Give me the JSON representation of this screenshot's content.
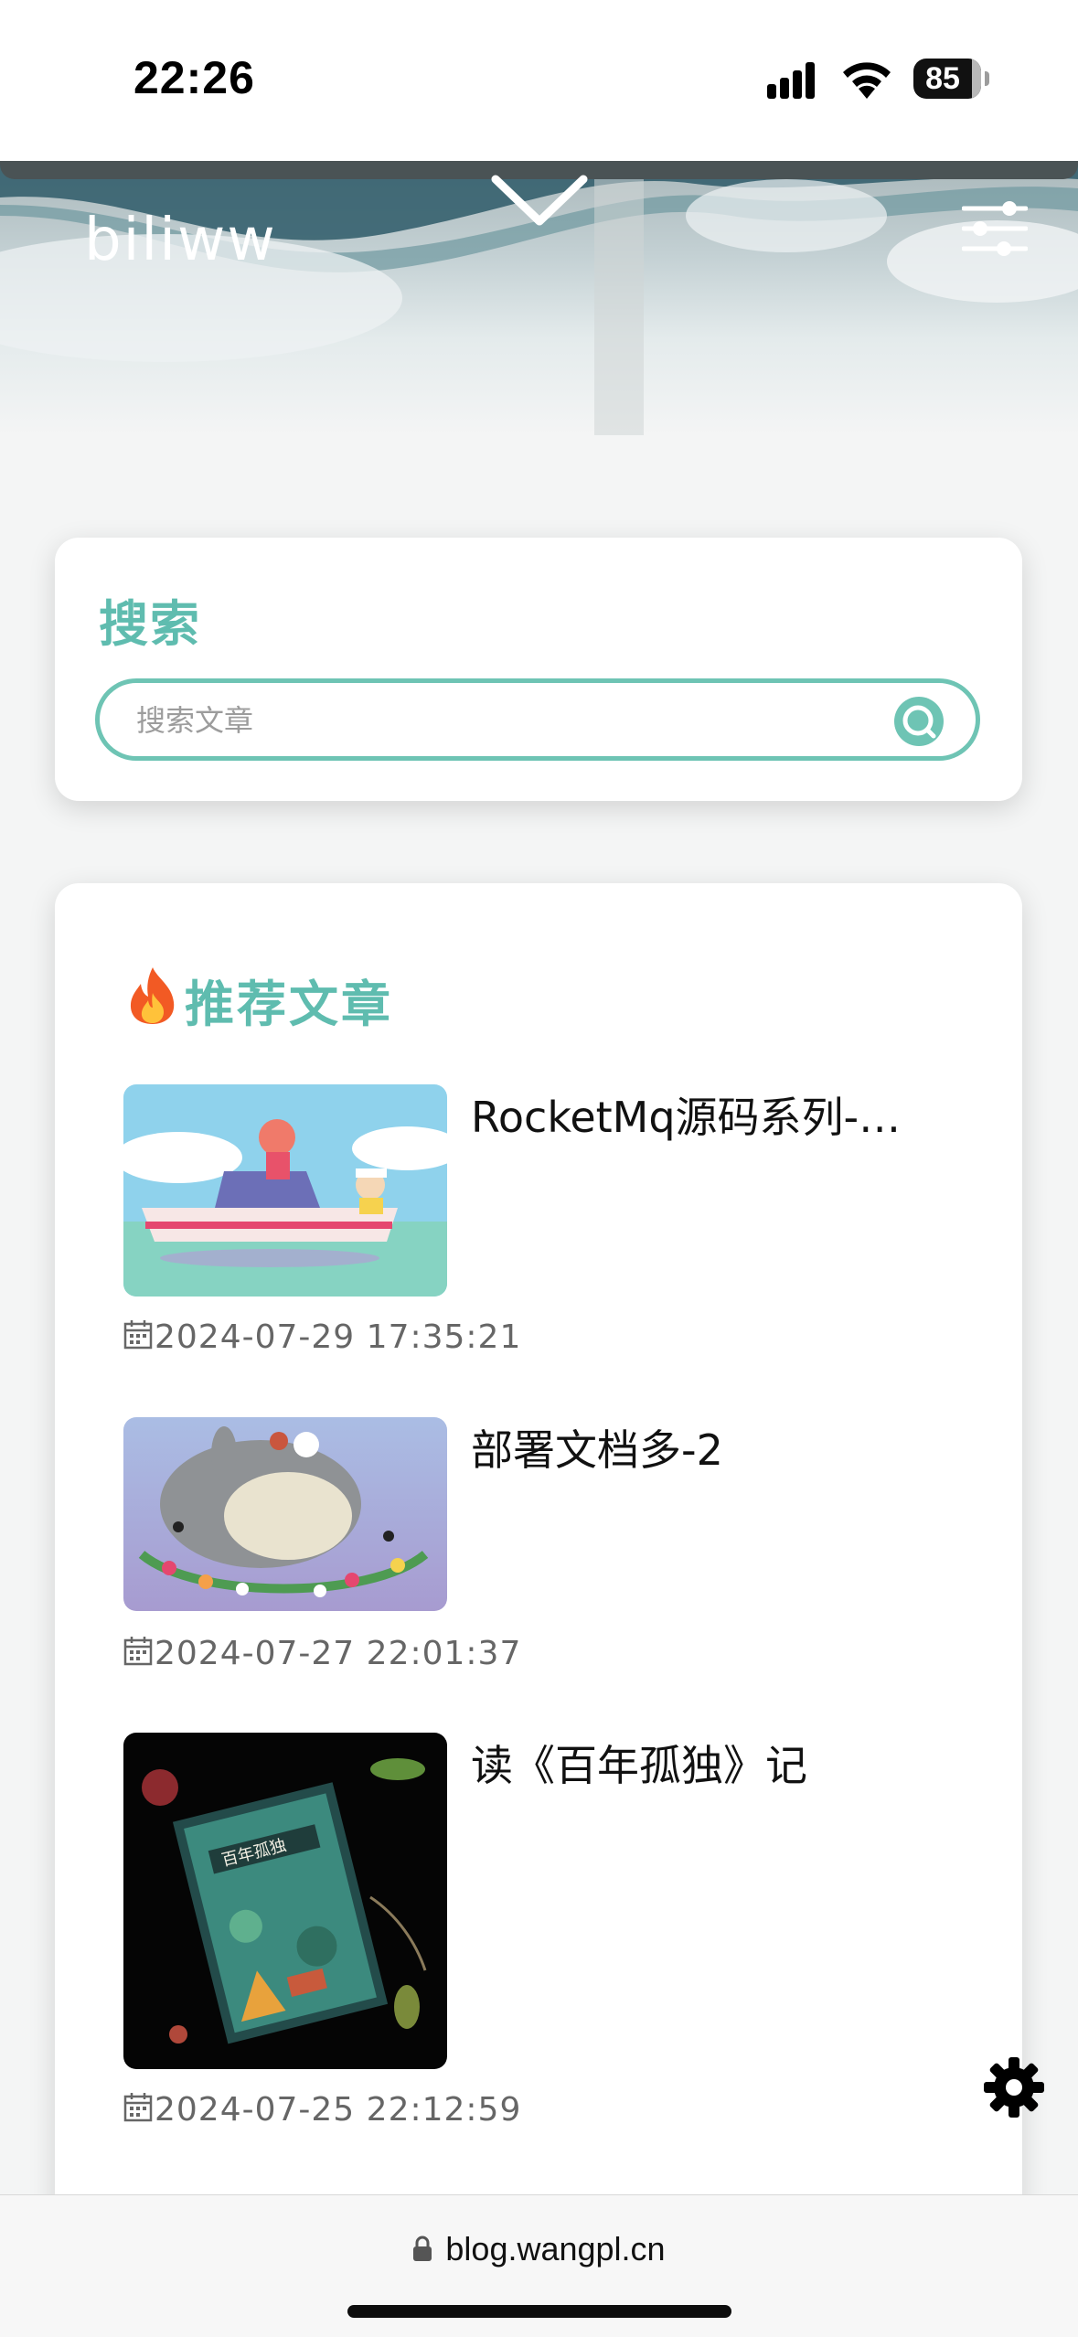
{
  "status_bar": {
    "time": "22:26",
    "battery": "85"
  },
  "header": {
    "site_title": "biliww"
  },
  "search": {
    "heading": "搜索",
    "placeholder": "搜索文章"
  },
  "recommended": {
    "heading": "推荐文章",
    "articles": [
      {
        "title": "RocketMq源码系列-…",
        "date": "2024-07-29 17:35:21"
      },
      {
        "title": "部署文档多-2",
        "date": "2024-07-27 22:01:37"
      },
      {
        "title": "读《百年孤独》记",
        "date": "2024-07-25 22:12:59"
      }
    ]
  },
  "browser": {
    "url": "blog.wangpl.cn"
  },
  "colors": {
    "accent": "#5fbcaf",
    "search_border": "#6ec4b4"
  },
  "icons": [
    "signal-icon",
    "wifi-icon",
    "battery-icon",
    "chevron-down-icon",
    "menu-icon",
    "search-icon",
    "fire-icon",
    "calendar-icon",
    "settings-icon",
    "lock-icon"
  ]
}
